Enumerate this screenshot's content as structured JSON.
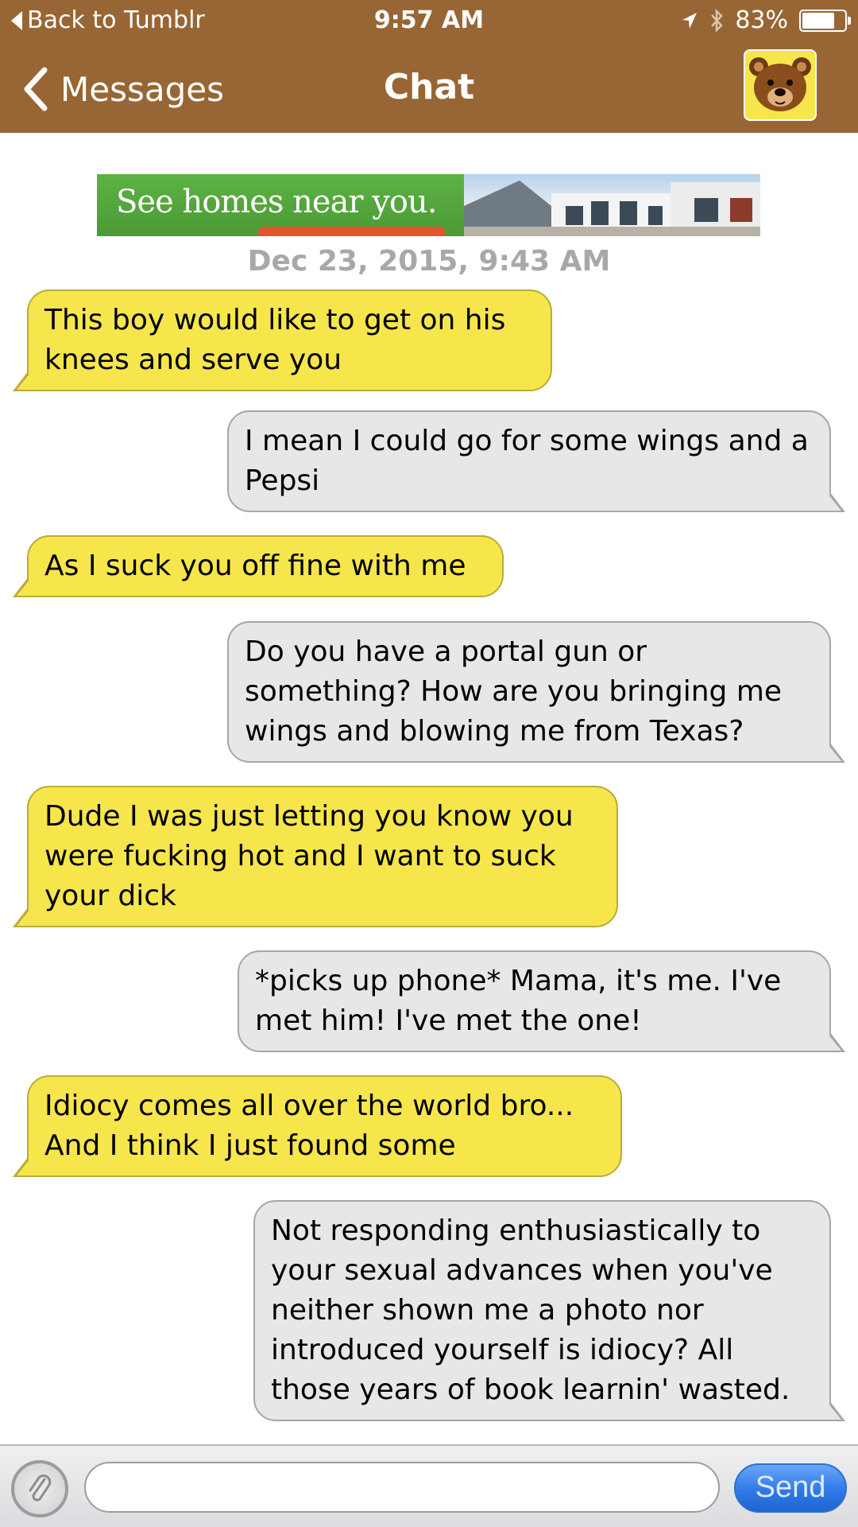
{
  "status_bar": {
    "back_label": "Back to Tumblr",
    "time": "9:57 AM",
    "battery": "83%",
    "battery_level": 0.83,
    "icons": [
      "location-arrow-icon",
      "bluetooth-icon",
      "battery-icon"
    ]
  },
  "nav": {
    "back_label": "Messages",
    "title": "Chat",
    "avatar_icon": "bear-icon"
  },
  "ad": {
    "text": "See homes near you."
  },
  "chat": {
    "date": "Dec 23, 2015, 9:43 AM",
    "messages": [
      {
        "side": "in",
        "text": "This boy would like to get on his knees and serve you"
      },
      {
        "side": "out",
        "text": "I mean I could go for some wings and a Pepsi"
      },
      {
        "side": "in",
        "text": "As I suck you off fine with me"
      },
      {
        "side": "out",
        "text": "Do you have a portal gun or something? How are you bringing me wings and blowing me from Texas?"
      },
      {
        "side": "in",
        "text": "Dude I was just letting you know you were fucking hot and I want to suck your dick"
      },
      {
        "side": "out",
        "text": "*picks up phone* Mama, it's me. I've met him! I've met the one!"
      },
      {
        "side": "in",
        "text": "Idiocy comes all over the world bro... And I think I just found some"
      },
      {
        "side": "out",
        "text": "Not responding enthusiastically to your sexual advances when you've neither shown me a photo nor introduced yourself is idiocy? All those years of book learnin' wasted."
      }
    ]
  },
  "composer": {
    "input_value": "",
    "send_label": "Send",
    "attach_icon": "paperclip-icon"
  },
  "colors": {
    "header": "#986634",
    "incoming_bubble": "#f6e64c",
    "outgoing_bubble": "#e7e7e9",
    "send_button": "#2e7ae8"
  }
}
